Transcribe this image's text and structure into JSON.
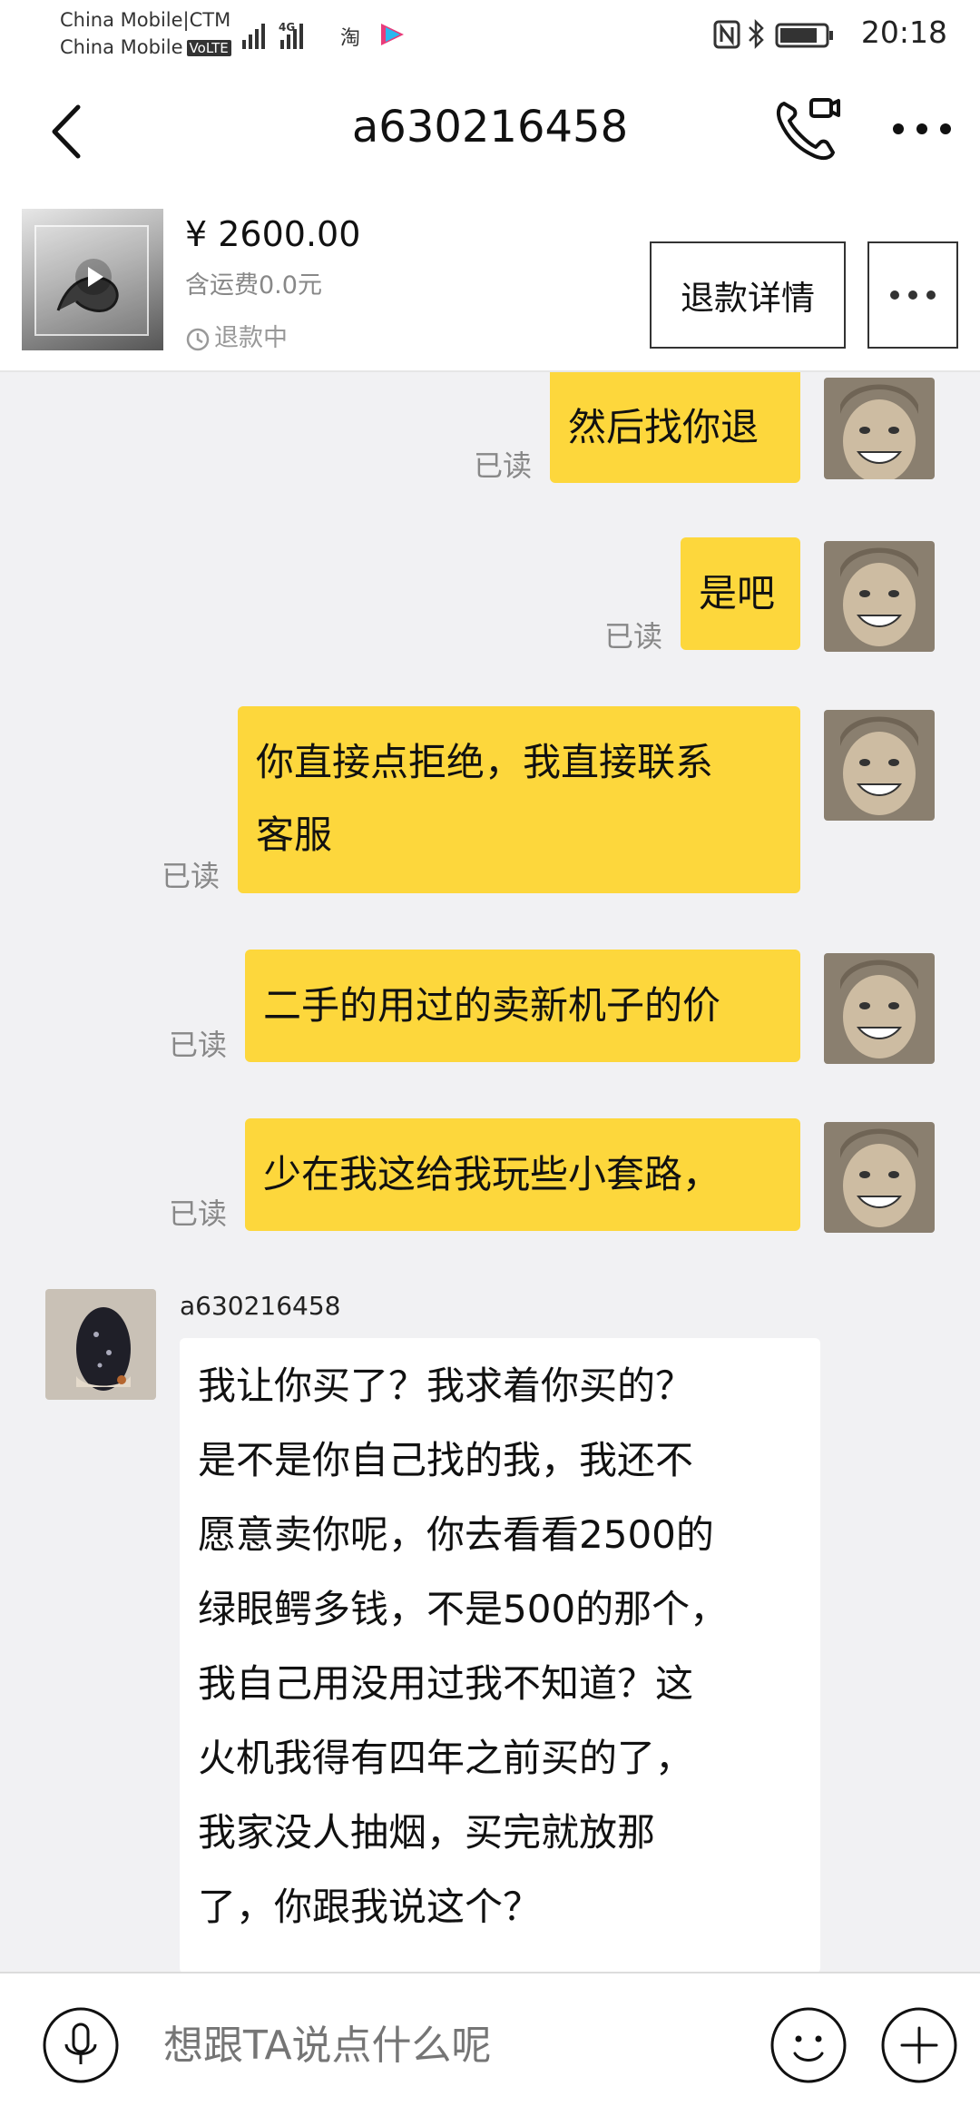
{
  "status_bar": {
    "carrier1": "China Mobile|CTM",
    "carrier2": "China Mobile",
    "volte": "VoLTE",
    "network": "4G",
    "time": "20:18"
  },
  "header": {
    "title": "a630216458",
    "back_icon": "chevron-left-icon",
    "call_icon": "phone-video-icon",
    "more_icon": "more-horizontal-icon"
  },
  "product": {
    "price": "¥ 2600.00",
    "shipping": "含运费0.0元",
    "status": "退款中",
    "refund_button": "退款详情"
  },
  "messages": [
    {
      "from": "me",
      "text": "然后找你退",
      "read": "已读"
    },
    {
      "from": "me",
      "text": "是吧",
      "read": "已读"
    },
    {
      "from": "me",
      "lines": [
        "你直接点拒绝，我直接联系",
        "客服"
      ],
      "read": "已读"
    },
    {
      "from": "me",
      "text": "二手的用过的卖新机子的价",
      "read": "已读"
    },
    {
      "from": "me",
      "text": "少在我这给我玩些小套路，",
      "read": "已读"
    },
    {
      "from": "other",
      "name": "a630216458",
      "lines": [
        "我让你买了？我求着你买的？",
        "是不是你自己找的我，我还不",
        "愿意卖你呢，你去看看2500的",
        "绿眼鳄多钱，不是500的那个，",
        "我自己用没用过我不知道？这",
        "火机我得有四年之前买的了，",
        "我家没人抽烟，买完就放那",
        "了，你跟我说这个？"
      ]
    }
  ],
  "input": {
    "placeholder": "想跟TA说点什么呢"
  },
  "colors": {
    "bubble_me": "#fdd73c",
    "bubble_other": "#ffffff",
    "background": "#f1f1f3"
  }
}
